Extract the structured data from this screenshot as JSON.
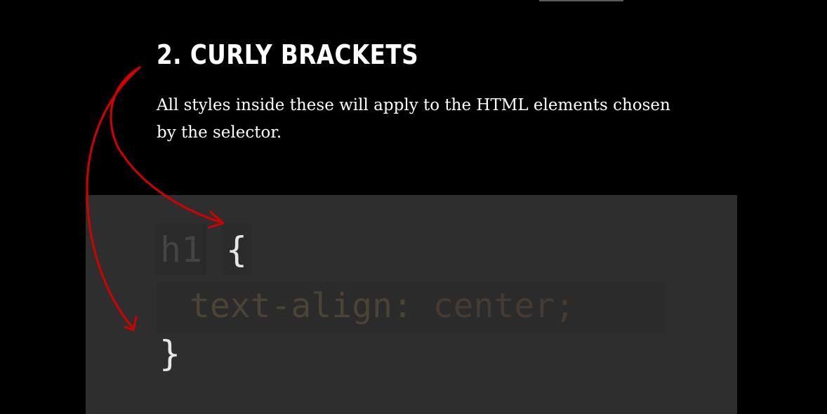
{
  "heading": "2. CURLY BRACKETS",
  "description": "All styles inside these will apply to the HTML elements chosen by the selector.",
  "code": {
    "selector": "h1",
    "open_brace": "{",
    "property": "text-align",
    "colon": ": ",
    "value": "center",
    "semicolon": ";",
    "close_brace": "}"
  },
  "colors": {
    "background": "#000000",
    "code_panel": "#2e2e2e",
    "arrow": "#d40000",
    "brace": "#e6e6e6"
  }
}
